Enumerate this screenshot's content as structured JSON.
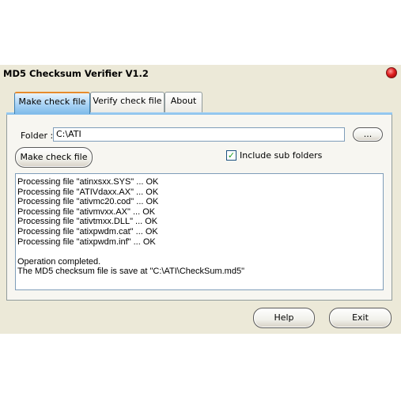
{
  "window": {
    "title": "MD5 Checksum Verifier V1.2"
  },
  "tabs": [
    {
      "label": "Make check file",
      "active": true
    },
    {
      "label": "Verify check file",
      "active": false
    },
    {
      "label": "About",
      "active": false
    }
  ],
  "make_check_file": {
    "folder_label": "Folder :",
    "folder_value": "C:\\ATI",
    "browse_label": "...",
    "make_button_label": "Make check file",
    "include_sub_folders_label": "Include sub folders",
    "include_sub_folders_checked": true,
    "log": [
      "Processing file \"atinxsxx.SYS\" ... OK",
      "Processing file \"ATIVdaxx.AX\" ... OK",
      "Processing file \"ativmc20.cod\" ... OK",
      "Processing file \"ativmvxx.AX\" ... OK",
      "Processing file \"ativtmxx.DLL\" ... OK",
      "Processing file \"atixpwdm.cat\" ... OK",
      "Processing file \"atixpwdm.inf\" ... OK",
      "",
      "Operation completed.",
      "The MD5 checksum file is save at \"C:\\ATI\\CheckSum.md5\""
    ]
  },
  "footer": {
    "help_label": "Help",
    "exit_label": "Exit"
  },
  "colors": {
    "window_bg": "#ece9d8",
    "close_button": "#e02020",
    "active_tab_top": "#e68b2c",
    "check_mark": "#21a121"
  }
}
